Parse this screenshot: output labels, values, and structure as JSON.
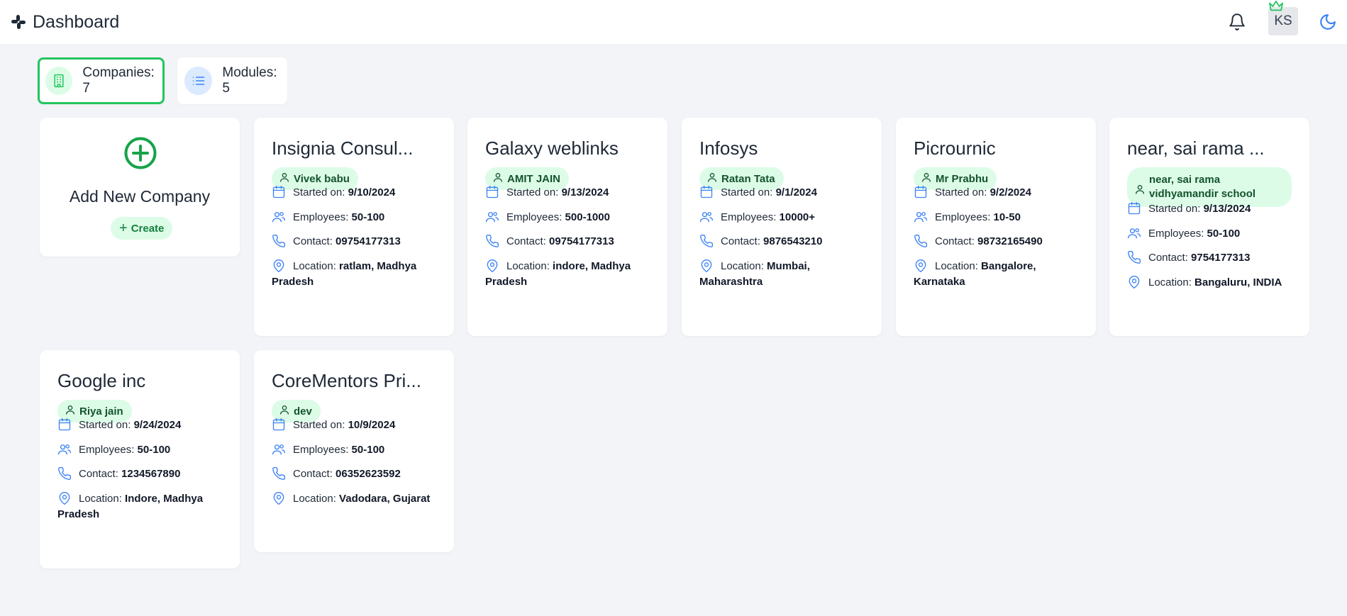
{
  "header": {
    "title": "Dashboard",
    "avatar_initials": "KS"
  },
  "stats": [
    {
      "label": "Companies: 7",
      "icon": "building-icon"
    },
    {
      "label": "Modules: 5",
      "icon": "list-icon"
    }
  ],
  "add_card": {
    "title": "Add New Company",
    "create_label": "Create"
  },
  "field_labels": {
    "started": "Started on: ",
    "employees": "Employees: ",
    "contact": "Contact: ",
    "location": "Location: "
  },
  "companies": [
    {
      "name": "Insignia Consul...",
      "owner": "Vivek babu",
      "started": "9/10/2024",
      "employees": "50-100",
      "contact": "09754177313",
      "location": "ratlam, Madhya Pradesh"
    },
    {
      "name": "Galaxy weblinks",
      "owner": "AMIT JAIN",
      "started": "9/13/2024",
      "employees": "500-1000",
      "contact": "09754177313",
      "location": "indore, Madhya Pradesh"
    },
    {
      "name": "Infosys",
      "owner": "Ratan Tata",
      "started": "9/1/2024",
      "employees": "10000+",
      "contact": "9876543210",
      "location": "Mumbai, Maharashtra"
    },
    {
      "name": "Picrournic",
      "owner": "Mr Prabhu",
      "started": "9/2/2024",
      "employees": "10-50",
      "contact": "98732165490",
      "location": "Bangalore, Karnataka"
    },
    {
      "name": "near, sai rama ...",
      "owner": "near, sai rama vidhyamandir school",
      "started": "9/13/2024",
      "employees": "50-100",
      "contact": "9754177313",
      "location": "Bangaluru, INDIA"
    },
    {
      "name": "Google inc",
      "owner": "Riya jain",
      "started": "9/24/2024",
      "employees": "50-100",
      "contact": "1234567890",
      "location": "Indore, Madhya Pradesh"
    },
    {
      "name": "CoreMentors Pri...",
      "owner": "dev",
      "started": "10/9/2024",
      "employees": "50-100",
      "contact": "06352623592",
      "location": "Vadodara, Gujarat"
    }
  ],
  "colors": {
    "accent": "#22c55e",
    "chip_bg": "#dcfce7",
    "icon_blue": "#3b82f6",
    "page_bg": "#f2f4f7"
  }
}
